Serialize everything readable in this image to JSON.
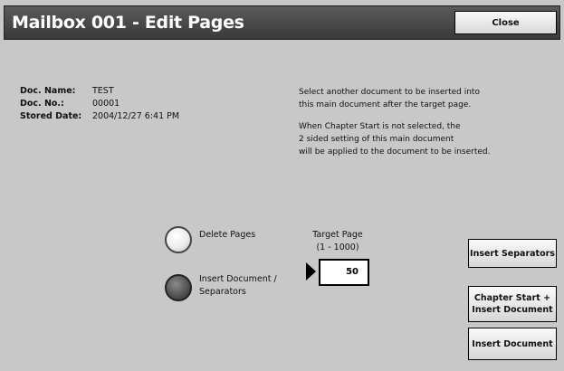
{
  "title": "Mailbox 001 - Edit Pages",
  "close_label": "Close",
  "doc_info": {
    "name_label": "Doc. Name:",
    "name_value": "TEST",
    "no_label": "Doc. No.:",
    "no_value": "00001",
    "date_label": "Stored Date:",
    "date_value": "2004/12/27 6:41 PM"
  },
  "message": {
    "line1": "Select another document to be inserted into",
    "line2": "this main document after the target page.",
    "line3": "When Chapter Start is not selected, the",
    "line4": "2 sided setting of this main document",
    "line5": "will be applied to the document to be inserted."
  },
  "options": {
    "delete_label": "Delete Pages",
    "insert_label_1": "Insert Document /",
    "insert_label_2": "Separators",
    "selected": "Insert Document / Separators"
  },
  "target_page": {
    "label": "Target Page",
    "range": "(1 - 1000)",
    "value": "50"
  },
  "side_buttons": {
    "separators": "Insert Separators",
    "chapter_line1": "Chapter Start +",
    "chapter_line2": "Insert Document",
    "insert_doc": "Insert Document"
  }
}
